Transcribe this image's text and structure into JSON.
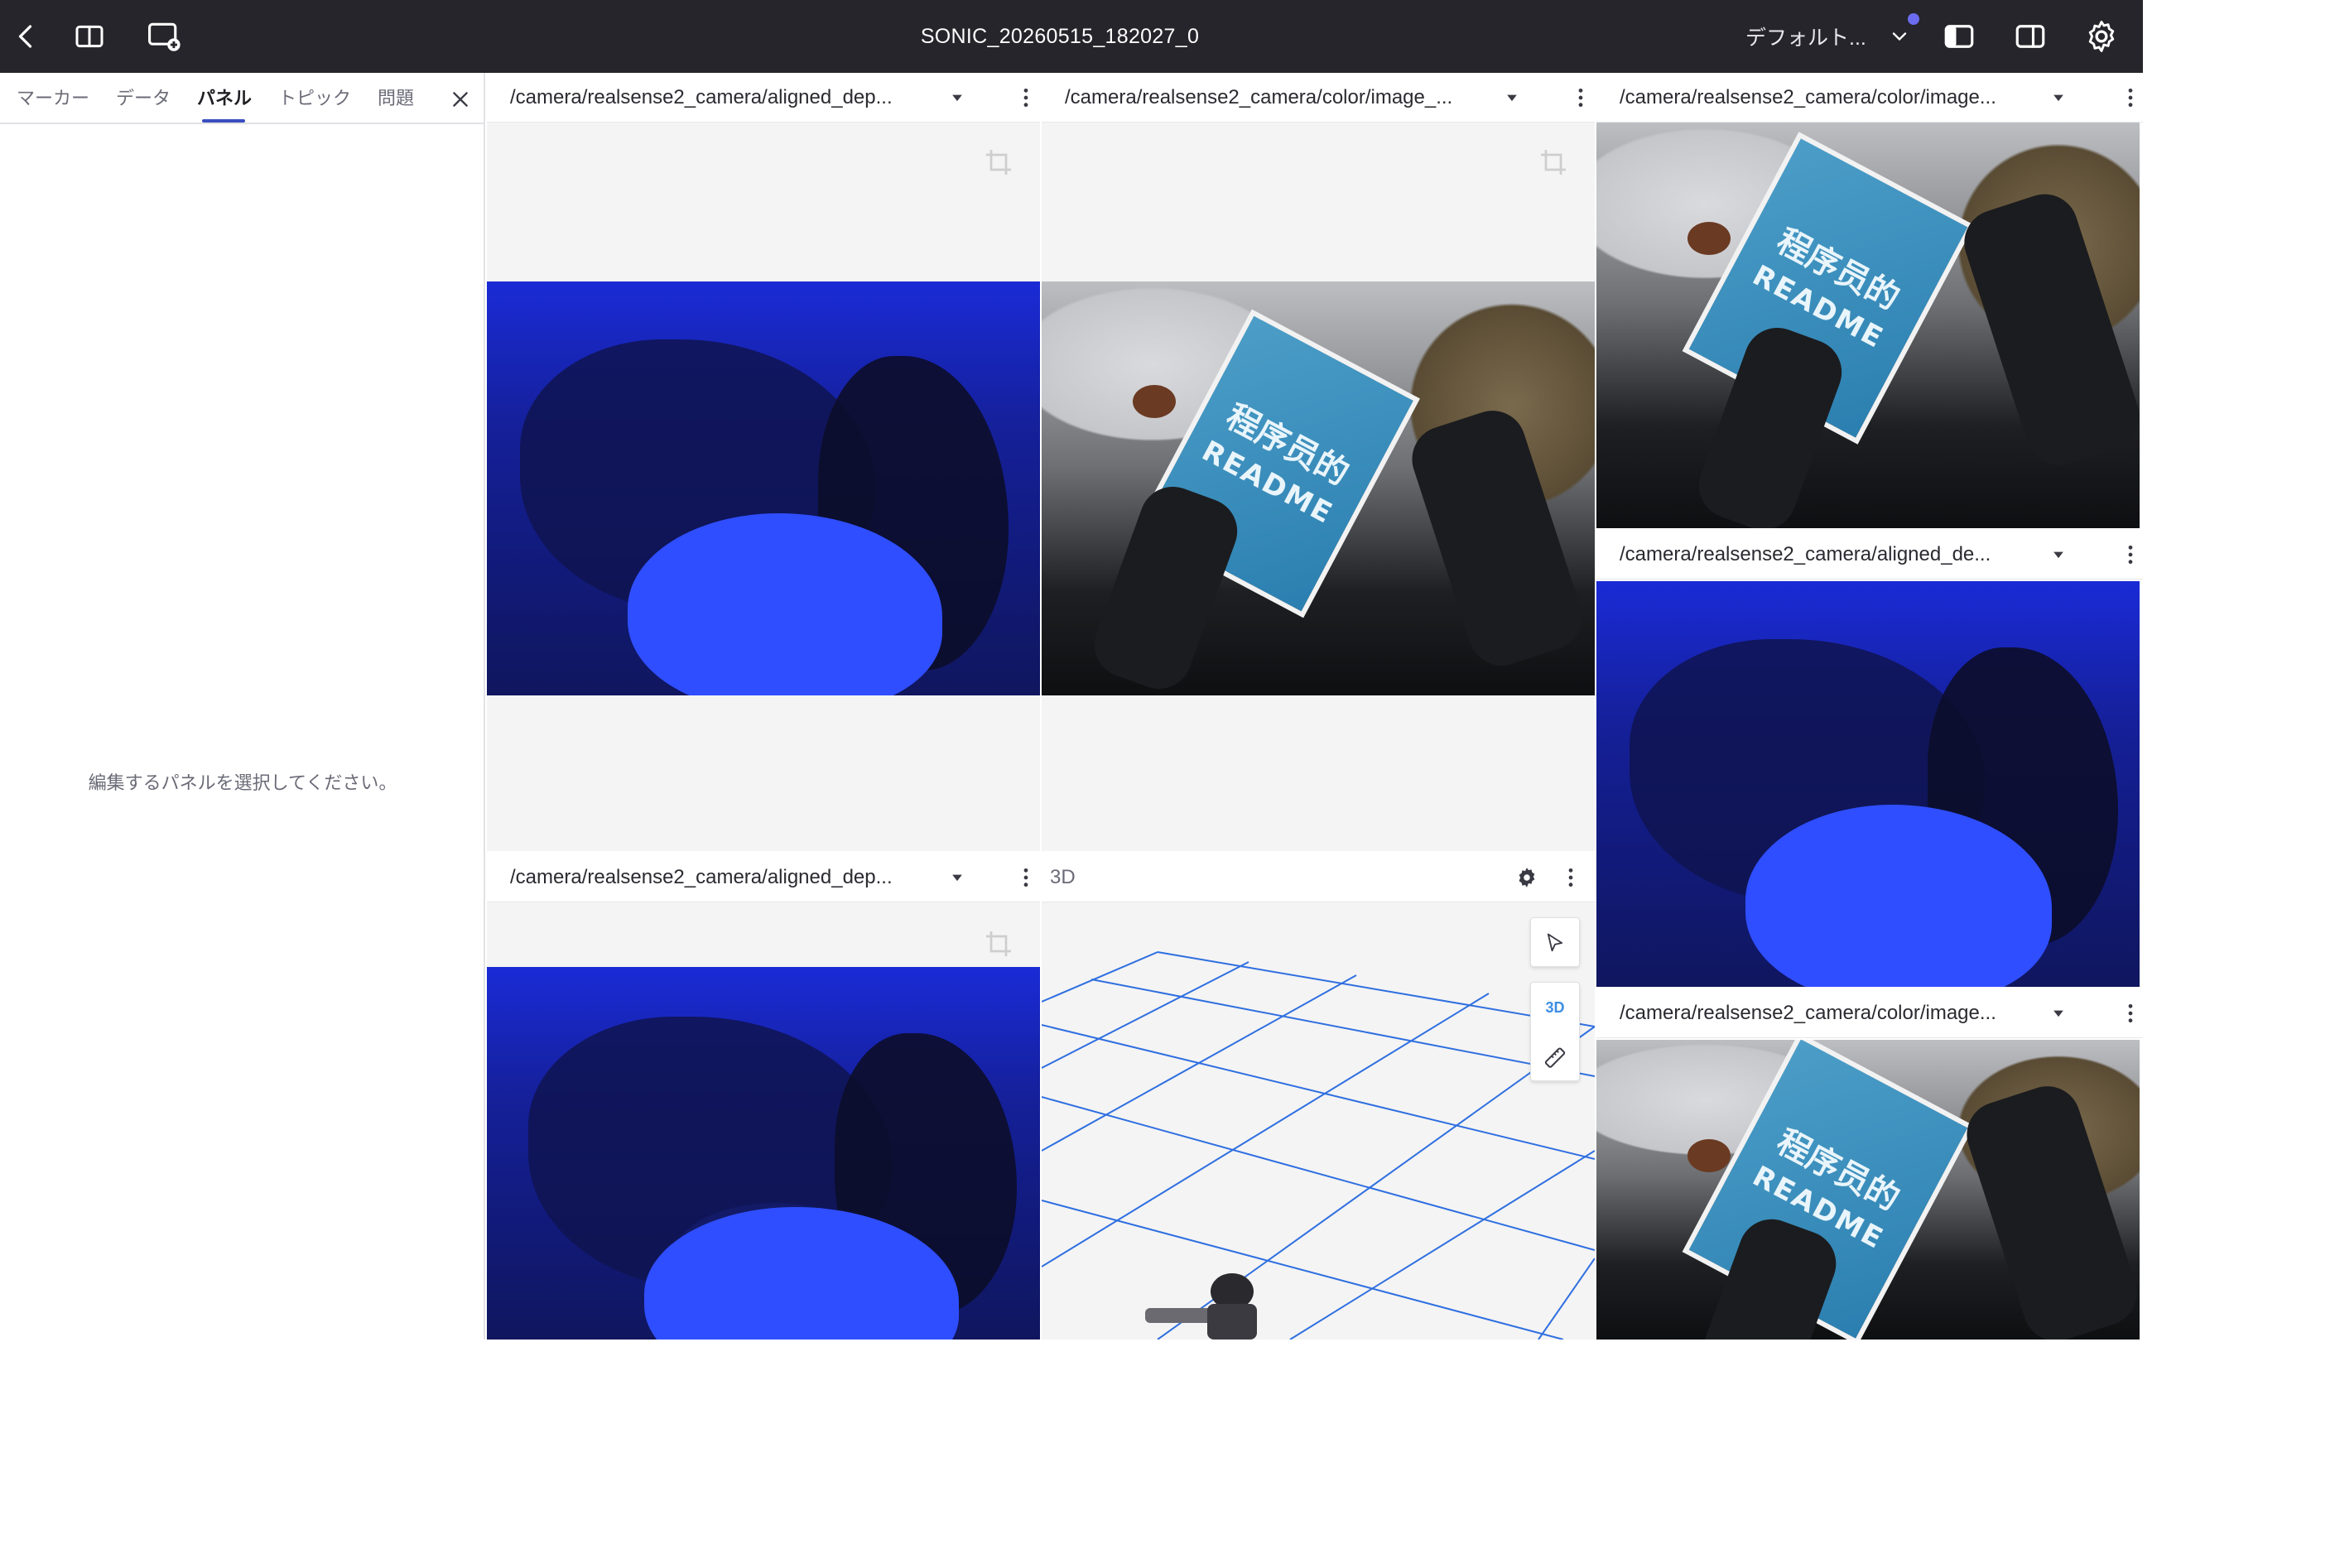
{
  "appbar": {
    "title": "SONIC_20260515_182027_0",
    "layout_label": "デフォルト...",
    "icons": [
      "back-icon",
      "panel-split-icon",
      "add-panel-icon",
      "chevron-down-icon",
      "left-sidebar-icon",
      "right-sidebar-icon",
      "gear-icon"
    ]
  },
  "sidebar": {
    "tabs": [
      {
        "label": "マーカー",
        "active": false
      },
      {
        "label": "データ",
        "active": false
      },
      {
        "label": "パネル",
        "active": true
      },
      {
        "label": "トピック",
        "active": false
      },
      {
        "label": "問題",
        "active": false
      }
    ],
    "empty_message": "編集するパネルを選択してください。"
  },
  "panels": [
    {
      "topic": "/camera/realsense2_camera/aligned_dep...",
      "kind": "depth"
    },
    {
      "topic": "/camera/realsense2_camera/color/image_...",
      "kind": "color"
    },
    {
      "topic": "/camera/realsense2_camera/color/image...",
      "kind": "color"
    },
    {
      "topic": "/camera/realsense2_camera/aligned_de...",
      "kind": "depth"
    },
    {
      "topic": "/camera/realsense2_camera/aligned_dep...",
      "kind": "depth"
    },
    {
      "topic": "3D",
      "kind": "3d"
    },
    {
      "topic": "/camera/realsense2_camera/color/image...",
      "kind": "color"
    }
  ],
  "book": {
    "title_line1": "程序员的",
    "title_line2": "README"
  },
  "view3d": {
    "mode_label": "3D"
  },
  "colors": {
    "appbar": "#25252b",
    "accent": "#3a4fbf",
    "grid": "#2f6fe0",
    "depth_blue": "#1a2bd6"
  }
}
